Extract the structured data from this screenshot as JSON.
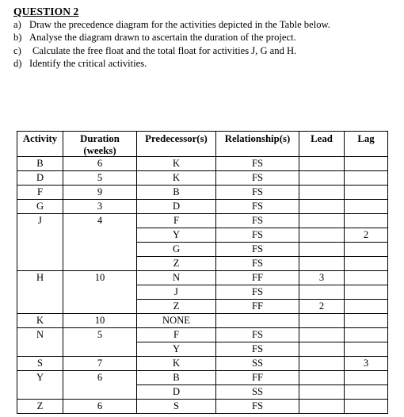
{
  "question": {
    "heading": "QUESTION 2",
    "items": [
      {
        "marker": "a)",
        "text": "Draw the precedence diagram for the activities depicted in the Table below.",
        "indented": false
      },
      {
        "marker": "b)",
        "text": "Analyse the diagram drawn to ascertain the duration of the project.",
        "indented": false
      },
      {
        "marker": "c)",
        "text": "Calculate the free float and the total float for activities J, G and H.",
        "indented": true
      },
      {
        "marker": "d)",
        "text": "Identify the critical activities.",
        "indented": false
      }
    ]
  },
  "table": {
    "headers": {
      "activity": "Activity",
      "duration_line1": "Duration",
      "duration_line2": "(weeks)",
      "predecessor": "Predecessor(s)",
      "relationship": "Relationship(s)",
      "lead": "Lead",
      "lag": "Lag"
    },
    "rows": [
      {
        "activity": "B",
        "duration": "6",
        "rowspan": 1,
        "lines": [
          {
            "predecessor": "K",
            "relationship": "FS",
            "lead": "",
            "lag": ""
          }
        ]
      },
      {
        "activity": "D",
        "duration": "5",
        "rowspan": 1,
        "lines": [
          {
            "predecessor": "K",
            "relationship": "FS",
            "lead": "",
            "lag": ""
          }
        ]
      },
      {
        "activity": "F",
        "duration": "9",
        "rowspan": 1,
        "lines": [
          {
            "predecessor": "B",
            "relationship": "FS",
            "lead": "",
            "lag": ""
          }
        ]
      },
      {
        "activity": "G",
        "duration": "3",
        "rowspan": 1,
        "lines": [
          {
            "predecessor": "D",
            "relationship": "FS",
            "lead": "",
            "lag": ""
          }
        ]
      },
      {
        "activity": "J",
        "duration": "4",
        "rowspan": 4,
        "lines": [
          {
            "predecessor": "F",
            "relationship": "FS",
            "lead": "",
            "lag": ""
          },
          {
            "predecessor": "Y",
            "relationship": "FS",
            "lead": "",
            "lag": "2"
          },
          {
            "predecessor": "G",
            "relationship": "FS",
            "lead": "",
            "lag": ""
          },
          {
            "predecessor": "Z",
            "relationship": "FS",
            "lead": "",
            "lag": ""
          }
        ]
      },
      {
        "activity": "H",
        "duration": "10",
        "rowspan": 3,
        "lines": [
          {
            "predecessor": "N",
            "relationship": "FF",
            "lead": "3",
            "lag": ""
          },
          {
            "predecessor": "J",
            "relationship": "FS",
            "lead": "",
            "lag": ""
          },
          {
            "predecessor": "Z",
            "relationship": "FF",
            "lead": "2",
            "lag": ""
          }
        ]
      },
      {
        "activity": "K",
        "duration": "10",
        "rowspan": 1,
        "lines": [
          {
            "predecessor": "NONE",
            "relationship": "",
            "lead": "",
            "lag": ""
          }
        ]
      },
      {
        "activity": "N",
        "duration": "5",
        "rowspan": 2,
        "lines": [
          {
            "predecessor": "F",
            "relationship": "FS",
            "lead": "",
            "lag": ""
          },
          {
            "predecessor": "Y",
            "relationship": "FS",
            "lead": "",
            "lag": ""
          }
        ]
      },
      {
        "activity": "S",
        "duration": "7",
        "rowspan": 1,
        "lines": [
          {
            "predecessor": "K",
            "relationship": "SS",
            "lead": "",
            "lag": "3"
          }
        ]
      },
      {
        "activity": "Y",
        "duration": "6",
        "rowspan": 2,
        "lines": [
          {
            "predecessor": "B",
            "relationship": "FF",
            "lead": "",
            "lag": ""
          },
          {
            "predecessor": "D",
            "relationship": "SS",
            "lead": "",
            "lag": ""
          }
        ]
      },
      {
        "activity": "Z",
        "duration": "6",
        "rowspan": 1,
        "lines": [
          {
            "predecessor": "S",
            "relationship": "FS",
            "lead": "",
            "lag": ""
          }
        ]
      }
    ]
  }
}
